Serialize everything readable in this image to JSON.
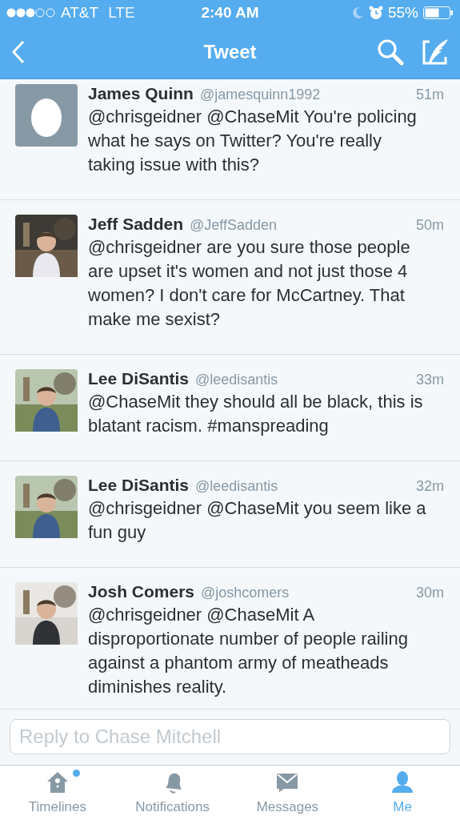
{
  "status_bar": {
    "carrier": "AT&T",
    "network": "LTE",
    "time": "2:40 AM",
    "battery": "55%"
  },
  "nav_bar": {
    "title": "Tweet"
  },
  "tweets": [
    {
      "name": "James Quinn",
      "handle": "@jamesquinn1992",
      "time": "51m",
      "text": "@chrisgeidner @ChaseMit You're policing what he says on Twitter? You're really taking issue with this?",
      "avatar": {
        "kind": "egg"
      }
    },
    {
      "name": "Jeff Sadden",
      "handle": "@JeffSadden",
      "time": "50m",
      "text": "@chrisgeidner are you sure those people are upset it's women and not just those 4 women? I don't care for McCartney. That make me sexist?"
    },
    {
      "name": "Lee DiSantis",
      "handle": "@leedisantis",
      "time": "33m",
      "text": "@ChaseMit  they should all be black, this is blatant racism. #manspreading"
    },
    {
      "name": "Lee DiSantis",
      "handle": "@leedisantis",
      "time": "32m",
      "text": "@chrisgeidner @ChaseMit  you seem like a fun guy"
    },
    {
      "name": "Josh Comers",
      "handle": "@joshcomers",
      "time": "30m",
      "text": "@chrisgeidner @ChaseMit A disproportionate number of people railing against a phantom army of meatheads diminishes reality."
    }
  ],
  "reply": {
    "placeholder": "Reply to Chase Mitchell"
  },
  "tab_bar": [
    {
      "label": "Timelines",
      "kind": "home",
      "selected": false,
      "badge": true
    },
    {
      "label": "Notifications",
      "kind": "bell",
      "selected": false,
      "badge": false
    },
    {
      "label": "Messages",
      "kind": "mail",
      "selected": false,
      "badge": false
    },
    {
      "label": "Me",
      "kind": "person",
      "selected": true,
      "badge": false
    }
  ]
}
